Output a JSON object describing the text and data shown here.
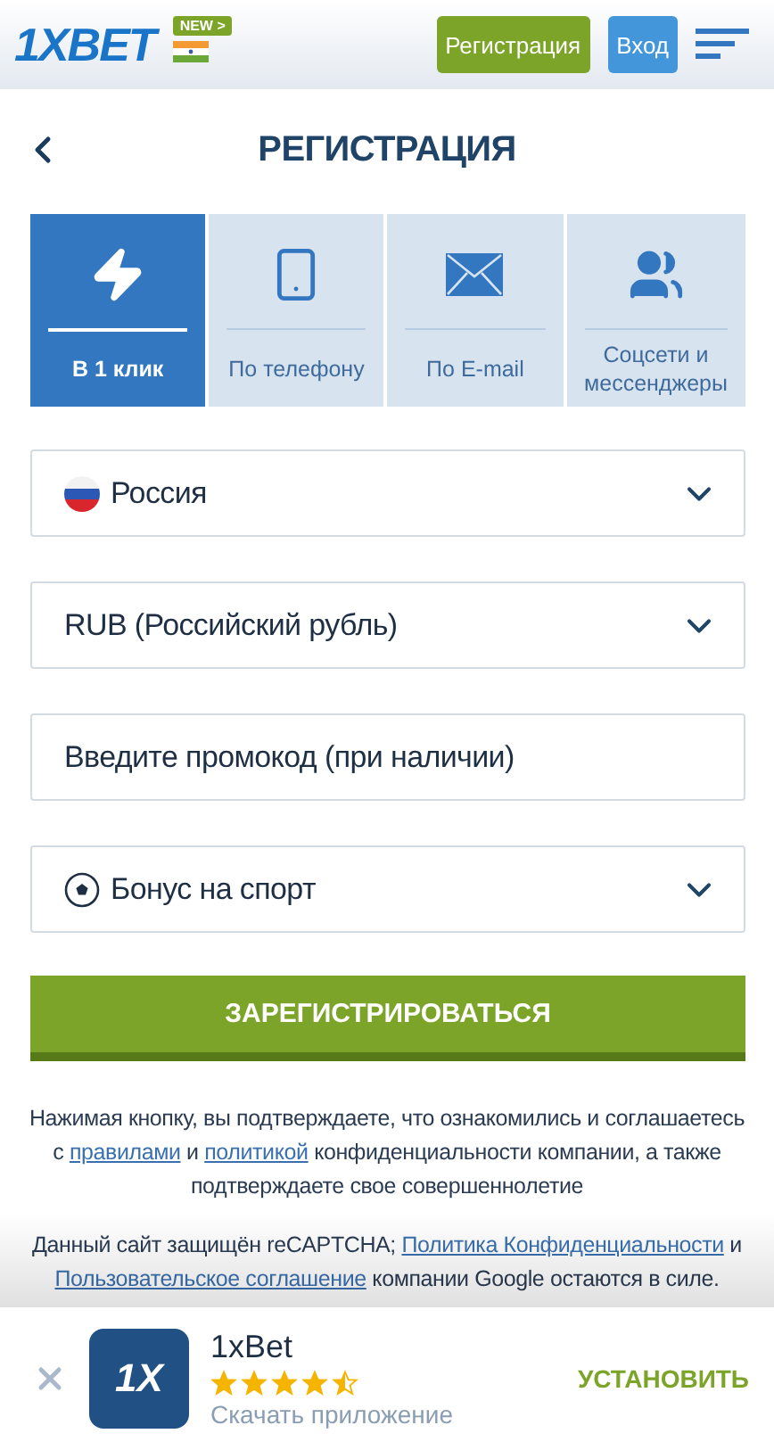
{
  "header": {
    "logo": "1XBET",
    "new_badge": "NEW >",
    "register_button": "Регистрация",
    "login_button": "Вход"
  },
  "page_title": "РЕГИСТРАЦИЯ",
  "tabs": [
    {
      "label": "В 1 клик",
      "selected": true
    },
    {
      "label": "По телефону",
      "selected": false
    },
    {
      "label": "По E-mail",
      "selected": false
    },
    {
      "label": "Соцсети и мессенджеры",
      "selected": false
    }
  ],
  "fields": [
    {
      "kind": "select",
      "value": "Россия"
    },
    {
      "kind": "select",
      "value": "RUB (Российский рубль)"
    },
    {
      "kind": "input",
      "placeholder": "Введите промокод (при наличии)"
    },
    {
      "kind": "select",
      "value": "Бонус на спорт"
    }
  ],
  "submit_button": "ЗАРЕГИСТРИРОВАТЬСЯ",
  "consent_text": [
    {
      "text": "Нажимая кнопку, вы подтверждаете, что ознакомились и соглашаетесь с ",
      "link": false
    },
    {
      "text": "правилами",
      "link": true
    },
    {
      "text": " и ",
      "link": false
    },
    {
      "text": "политикой",
      "link": true
    },
    {
      "text": " конфиденциальности компании, а также подтверждаете свое совершеннолетие",
      "link": false
    }
  ],
  "recaptcha_text": [
    {
      "text": "Данный сайт защищён reCAPTCHA; ",
      "link": false
    },
    {
      "text": "Политика Конфиденциальности",
      "link": true
    },
    {
      "text": " и ",
      "link": false
    },
    {
      "text": "Пользовательское соглашение",
      "link": true
    },
    {
      "text": " компании Google остаются в силе.",
      "link": false
    }
  ],
  "app_banner": {
    "logo": "1X",
    "name": "1xBet",
    "stars": 4.5,
    "subtitle": "Скачать приложение",
    "install_button": "УСТАНОВИТЬ"
  }
}
